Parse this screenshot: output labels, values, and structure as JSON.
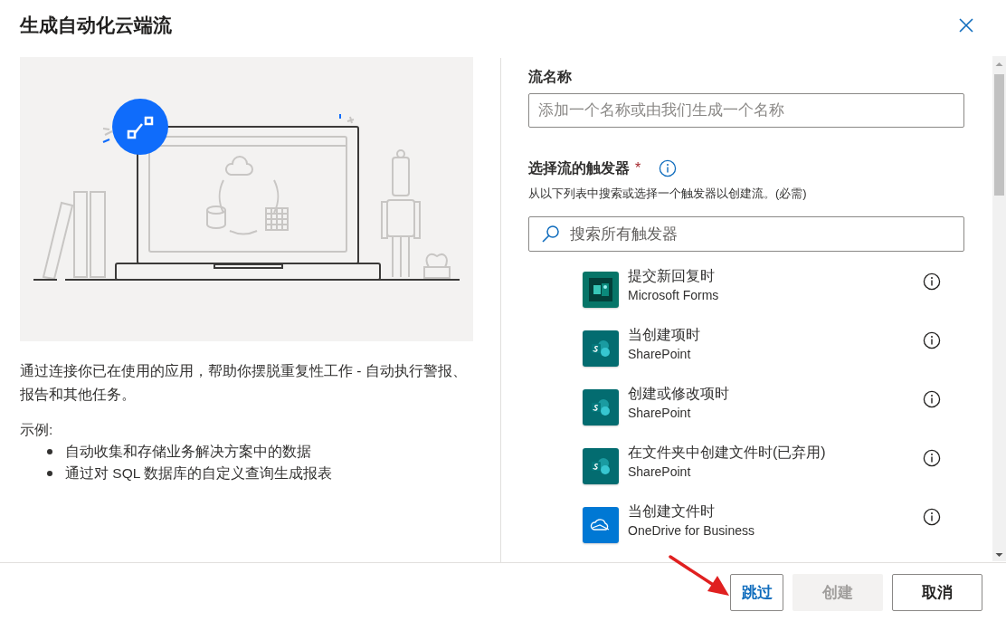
{
  "dialog": {
    "title": "生成自动化云端流"
  },
  "description": "通过连接你已在使用的应用，帮助你摆脱重复性工作 - 自动执行警报、报告和其他任务。",
  "examples": {
    "heading": "示例:",
    "items": [
      "自动收集和存储业务解决方案中的数据",
      "通过对 SQL 数据库的自定义查询生成报表"
    ]
  },
  "flow_name": {
    "label": "流名称",
    "placeholder": "添加一个名称或由我们生成一个名称"
  },
  "trigger": {
    "label": "选择流的触发器",
    "required_mark": "*",
    "hint": "从以下列表中搜索或选择一个触发器以创建流。(必需)",
    "search_placeholder": "搜索所有触发器"
  },
  "triggers": [
    {
      "title": "提交新回复时",
      "connector": "Microsoft Forms",
      "kind": "forms"
    },
    {
      "title": "当创建项时",
      "connector": "SharePoint",
      "kind": "sharepoint"
    },
    {
      "title": "创建或修改项时",
      "connector": "SharePoint",
      "kind": "sharepoint"
    },
    {
      "title": "在文件夹中创建文件时(已弃用)",
      "connector": "SharePoint",
      "kind": "sharepoint"
    },
    {
      "title": "当创建文件时",
      "connector": "OneDrive for Business",
      "kind": "onedrive"
    }
  ],
  "buttons": [
    {
      "label": "跳过",
      "kind": "skip",
      "disabled": false
    },
    {
      "label": "创建",
      "kind": "create",
      "disabled": true
    },
    {
      "label": "取消",
      "kind": "cancel",
      "disabled": false
    }
  ]
}
